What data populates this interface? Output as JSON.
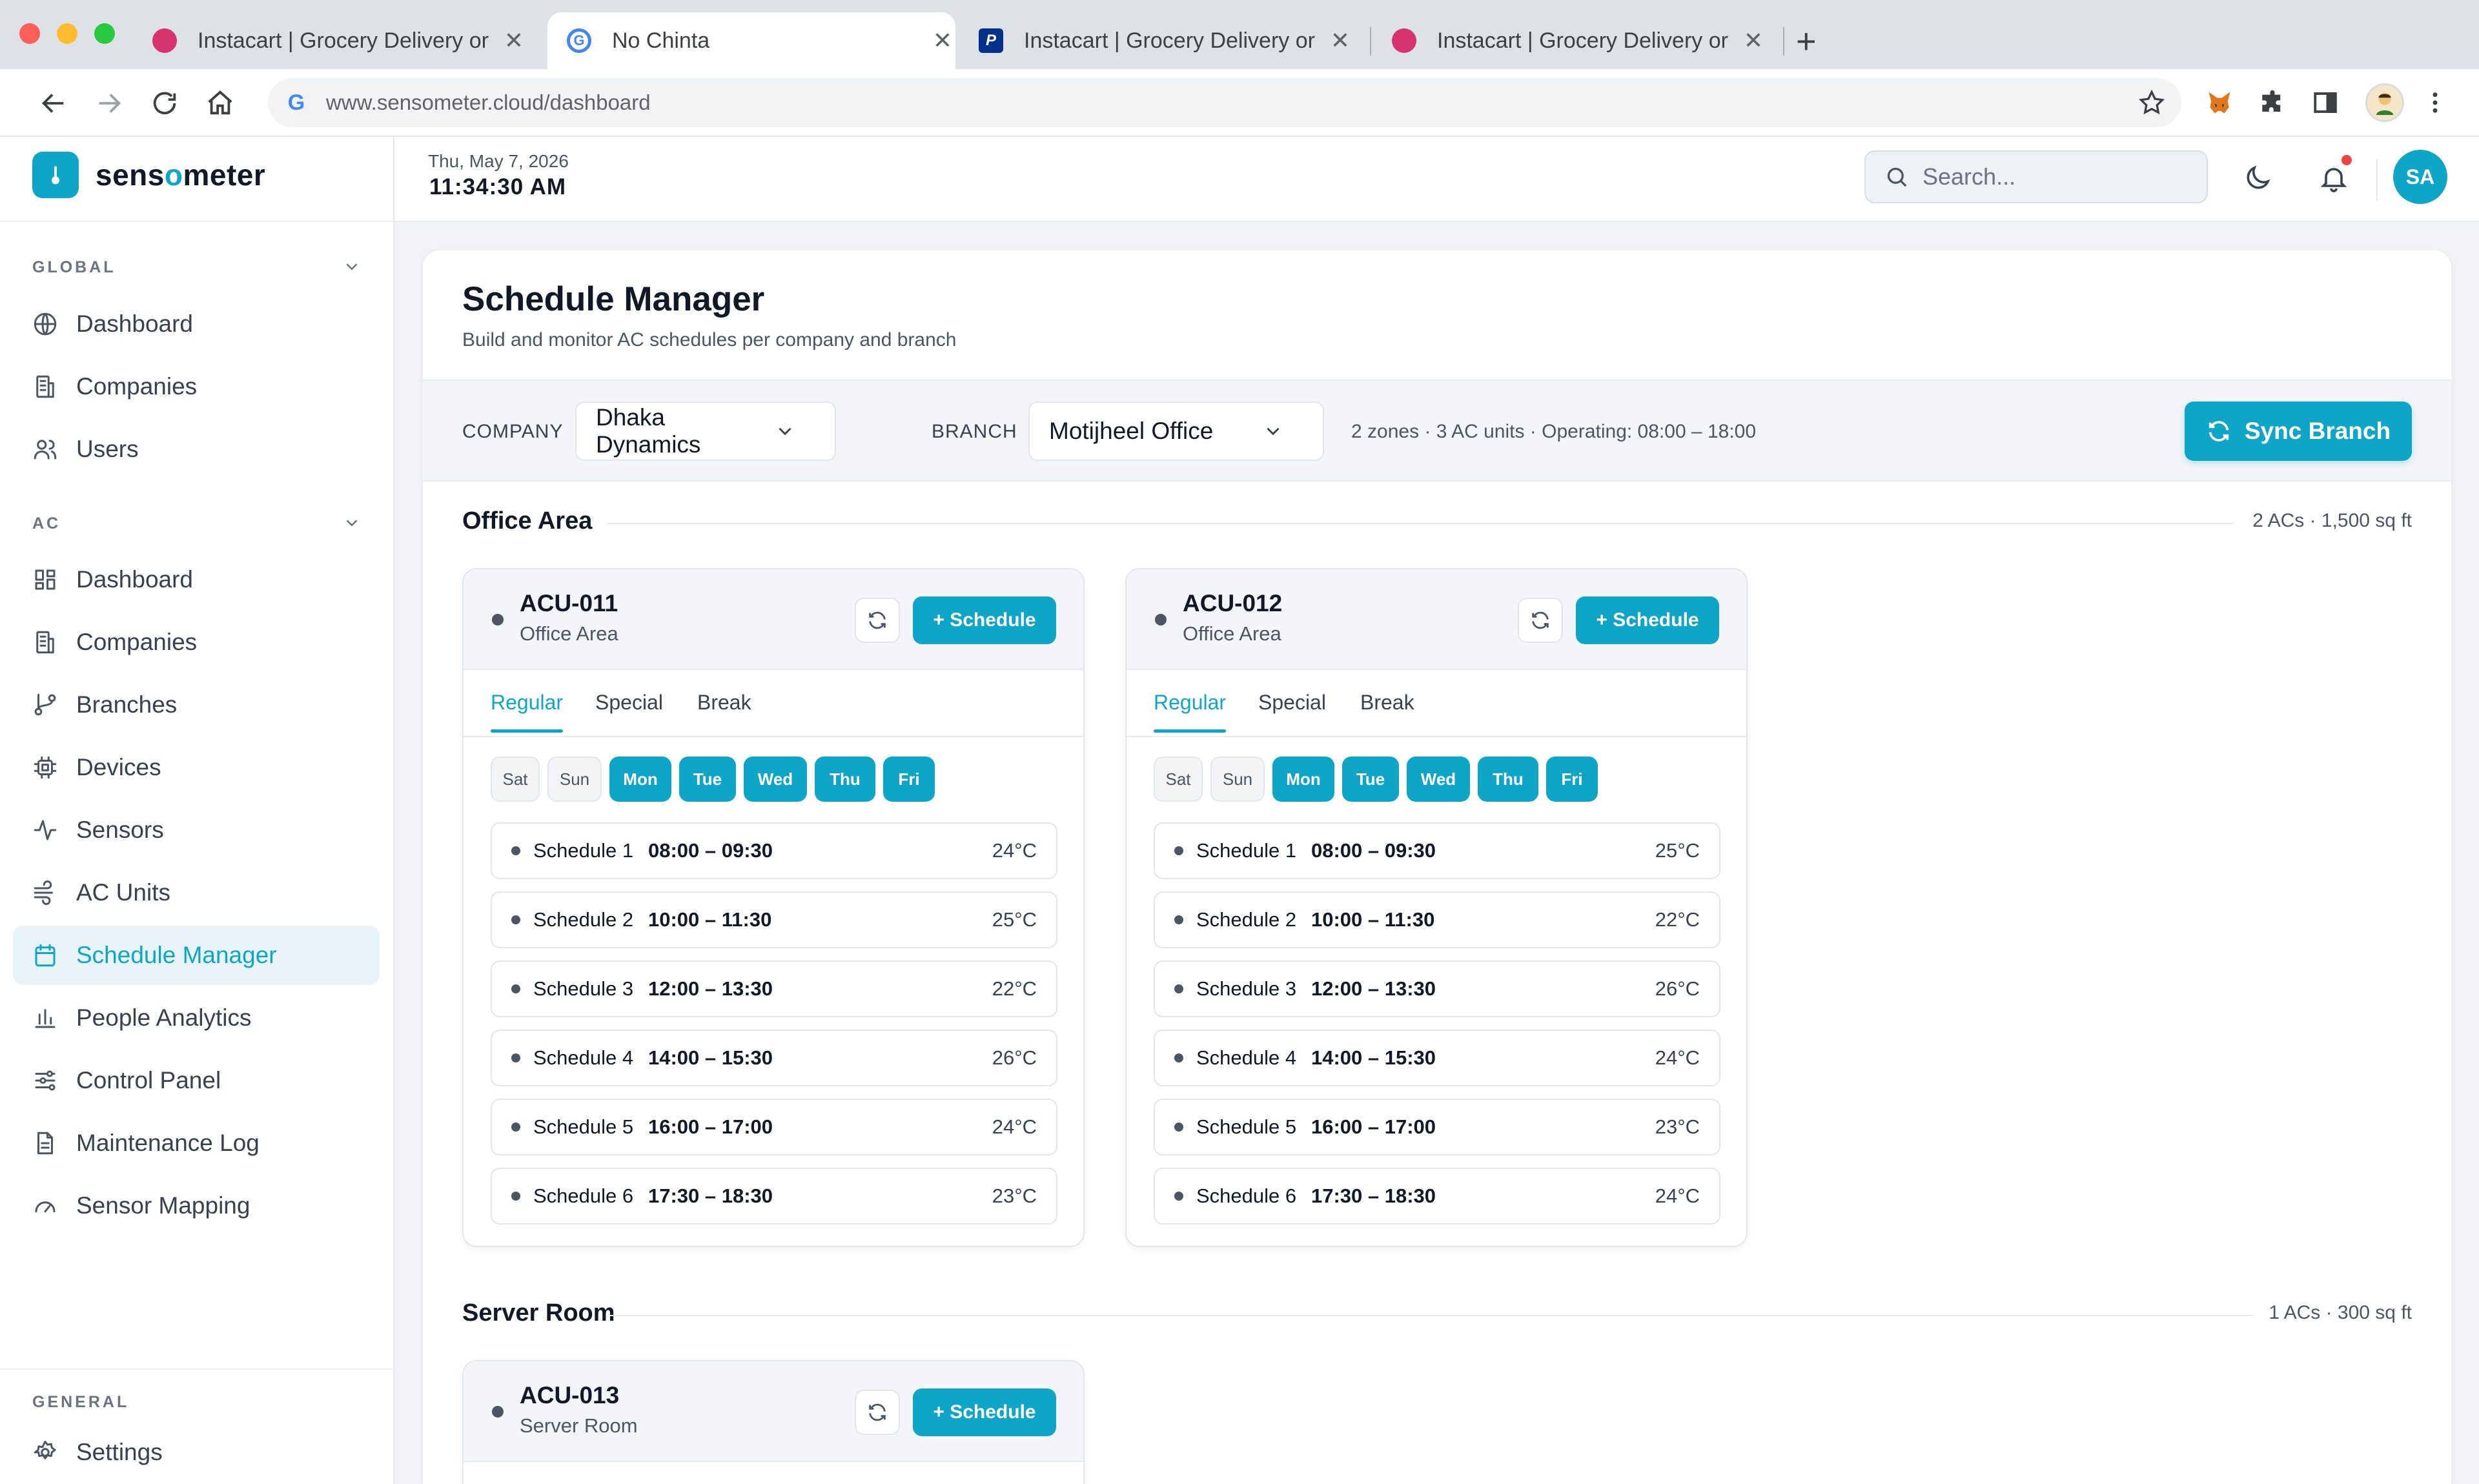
{
  "browser": {
    "tabs": [
      {
        "title": "Instacart | Grocery Delivery or"
      },
      {
        "title": "No Chinta"
      },
      {
        "title": "Instacart | Grocery Delivery or"
      },
      {
        "title": "Instacart | Grocery Delivery or"
      }
    ],
    "url": "www.sensometer.cloud/dashboard"
  },
  "app": {
    "brand_prefix": "sens",
    "brand_o": "o",
    "brand_suffix": "meter"
  },
  "header": {
    "date": "Thu, May 7, 2026",
    "time": "11:34:30 AM",
    "search_placeholder": "Search...",
    "avatar_initials": "SA"
  },
  "sidebar": {
    "global_label": "GLOBAL",
    "global_items": [
      {
        "label": "Dashboard",
        "icon": "globe-icon"
      },
      {
        "label": "Companies",
        "icon": "building-icon"
      },
      {
        "label": "Users",
        "icon": "users-icon"
      }
    ],
    "ac_label": "AC",
    "ac_items": [
      {
        "label": "Dashboard",
        "icon": "grid-icon"
      },
      {
        "label": "Companies",
        "icon": "building-icon"
      },
      {
        "label": "Branches",
        "icon": "git-branch-icon"
      },
      {
        "label": "Devices",
        "icon": "chip-icon"
      },
      {
        "label": "Sensors",
        "icon": "activity-icon"
      },
      {
        "label": "AC Units",
        "icon": "wind-icon"
      },
      {
        "label": "Schedule Manager",
        "icon": "calendar-icon",
        "active": true
      },
      {
        "label": "People Analytics",
        "icon": "bar-chart-icon"
      },
      {
        "label": "Control Panel",
        "icon": "sliders-icon"
      },
      {
        "label": "Maintenance Log",
        "icon": "document-icon"
      },
      {
        "label": "Sensor Mapping",
        "icon": "gauge-icon"
      }
    ],
    "general_label": "GENERAL",
    "general_items": [
      {
        "label": "Settings",
        "icon": "gear-icon"
      }
    ]
  },
  "page": {
    "title": "Schedule Manager",
    "subtitle": "Build and monitor AC schedules per company and branch",
    "company_label": "COMPANY",
    "company_value": "Dhaka Dynamics",
    "branch_label": "BRANCH",
    "branch_value": "Motijheel Office",
    "branch_info": "2 zones · 3 AC units · Operating: 08:00 – 18:00",
    "sync_label": "Sync Branch"
  },
  "zones": [
    {
      "name": "Office Area",
      "meta": "2 ACs · 1,500 sq ft",
      "units": [
        {
          "id": "ACU-011",
          "zone": "Office Area",
          "add_label": "+ Schedule",
          "tabs": [
            "Regular",
            "Special",
            "Break"
          ],
          "days": [
            {
              "label": "Sat",
              "on": false
            },
            {
              "label": "Sun",
              "on": false
            },
            {
              "label": "Mon",
              "on": true
            },
            {
              "label": "Tue",
              "on": true
            },
            {
              "label": "Wed",
              "on": true
            },
            {
              "label": "Thu",
              "on": true
            },
            {
              "label": "Fri",
              "on": true
            }
          ],
          "schedules": [
            {
              "name": "Schedule 1",
              "time": "08:00 – 09:30",
              "temp": "24°C"
            },
            {
              "name": "Schedule 2",
              "time": "10:00 – 11:30",
              "temp": "25°C"
            },
            {
              "name": "Schedule 3",
              "time": "12:00 – 13:30",
              "temp": "22°C"
            },
            {
              "name": "Schedule 4",
              "time": "14:00 – 15:30",
              "temp": "26°C"
            },
            {
              "name": "Schedule 5",
              "time": "16:00 – 17:00",
              "temp": "24°C"
            },
            {
              "name": "Schedule 6",
              "time": "17:30 – 18:30",
              "temp": "23°C"
            }
          ]
        },
        {
          "id": "ACU-012",
          "zone": "Office Area",
          "add_label": "+ Schedule",
          "tabs": [
            "Regular",
            "Special",
            "Break"
          ],
          "days": [
            {
              "label": "Sat",
              "on": false
            },
            {
              "label": "Sun",
              "on": false
            },
            {
              "label": "Mon",
              "on": true
            },
            {
              "label": "Tue",
              "on": true
            },
            {
              "label": "Wed",
              "on": true
            },
            {
              "label": "Thu",
              "on": true
            },
            {
              "label": "Fri",
              "on": true
            }
          ],
          "schedules": [
            {
              "name": "Schedule 1",
              "time": "08:00 – 09:30",
              "temp": "25°C"
            },
            {
              "name": "Schedule 2",
              "time": "10:00 – 11:30",
              "temp": "22°C"
            },
            {
              "name": "Schedule 3",
              "time": "12:00 – 13:30",
              "temp": "26°C"
            },
            {
              "name": "Schedule 4",
              "time": "14:00 – 15:30",
              "temp": "24°C"
            },
            {
              "name": "Schedule 5",
              "time": "16:00 – 17:00",
              "temp": "23°C"
            },
            {
              "name": "Schedule 6",
              "time": "17:30 – 18:30",
              "temp": "24°C"
            }
          ]
        }
      ]
    },
    {
      "name": "Server Room",
      "meta": "1 ACs · 300 sq ft",
      "units": [
        {
          "id": "ACU-013",
          "zone": "Server Room",
          "add_label": "+ Schedule"
        }
      ]
    }
  ],
  "colors": {
    "accent": "#0ea5c6",
    "active_bg": "#e8f3f7",
    "notification": "#ef4444"
  }
}
